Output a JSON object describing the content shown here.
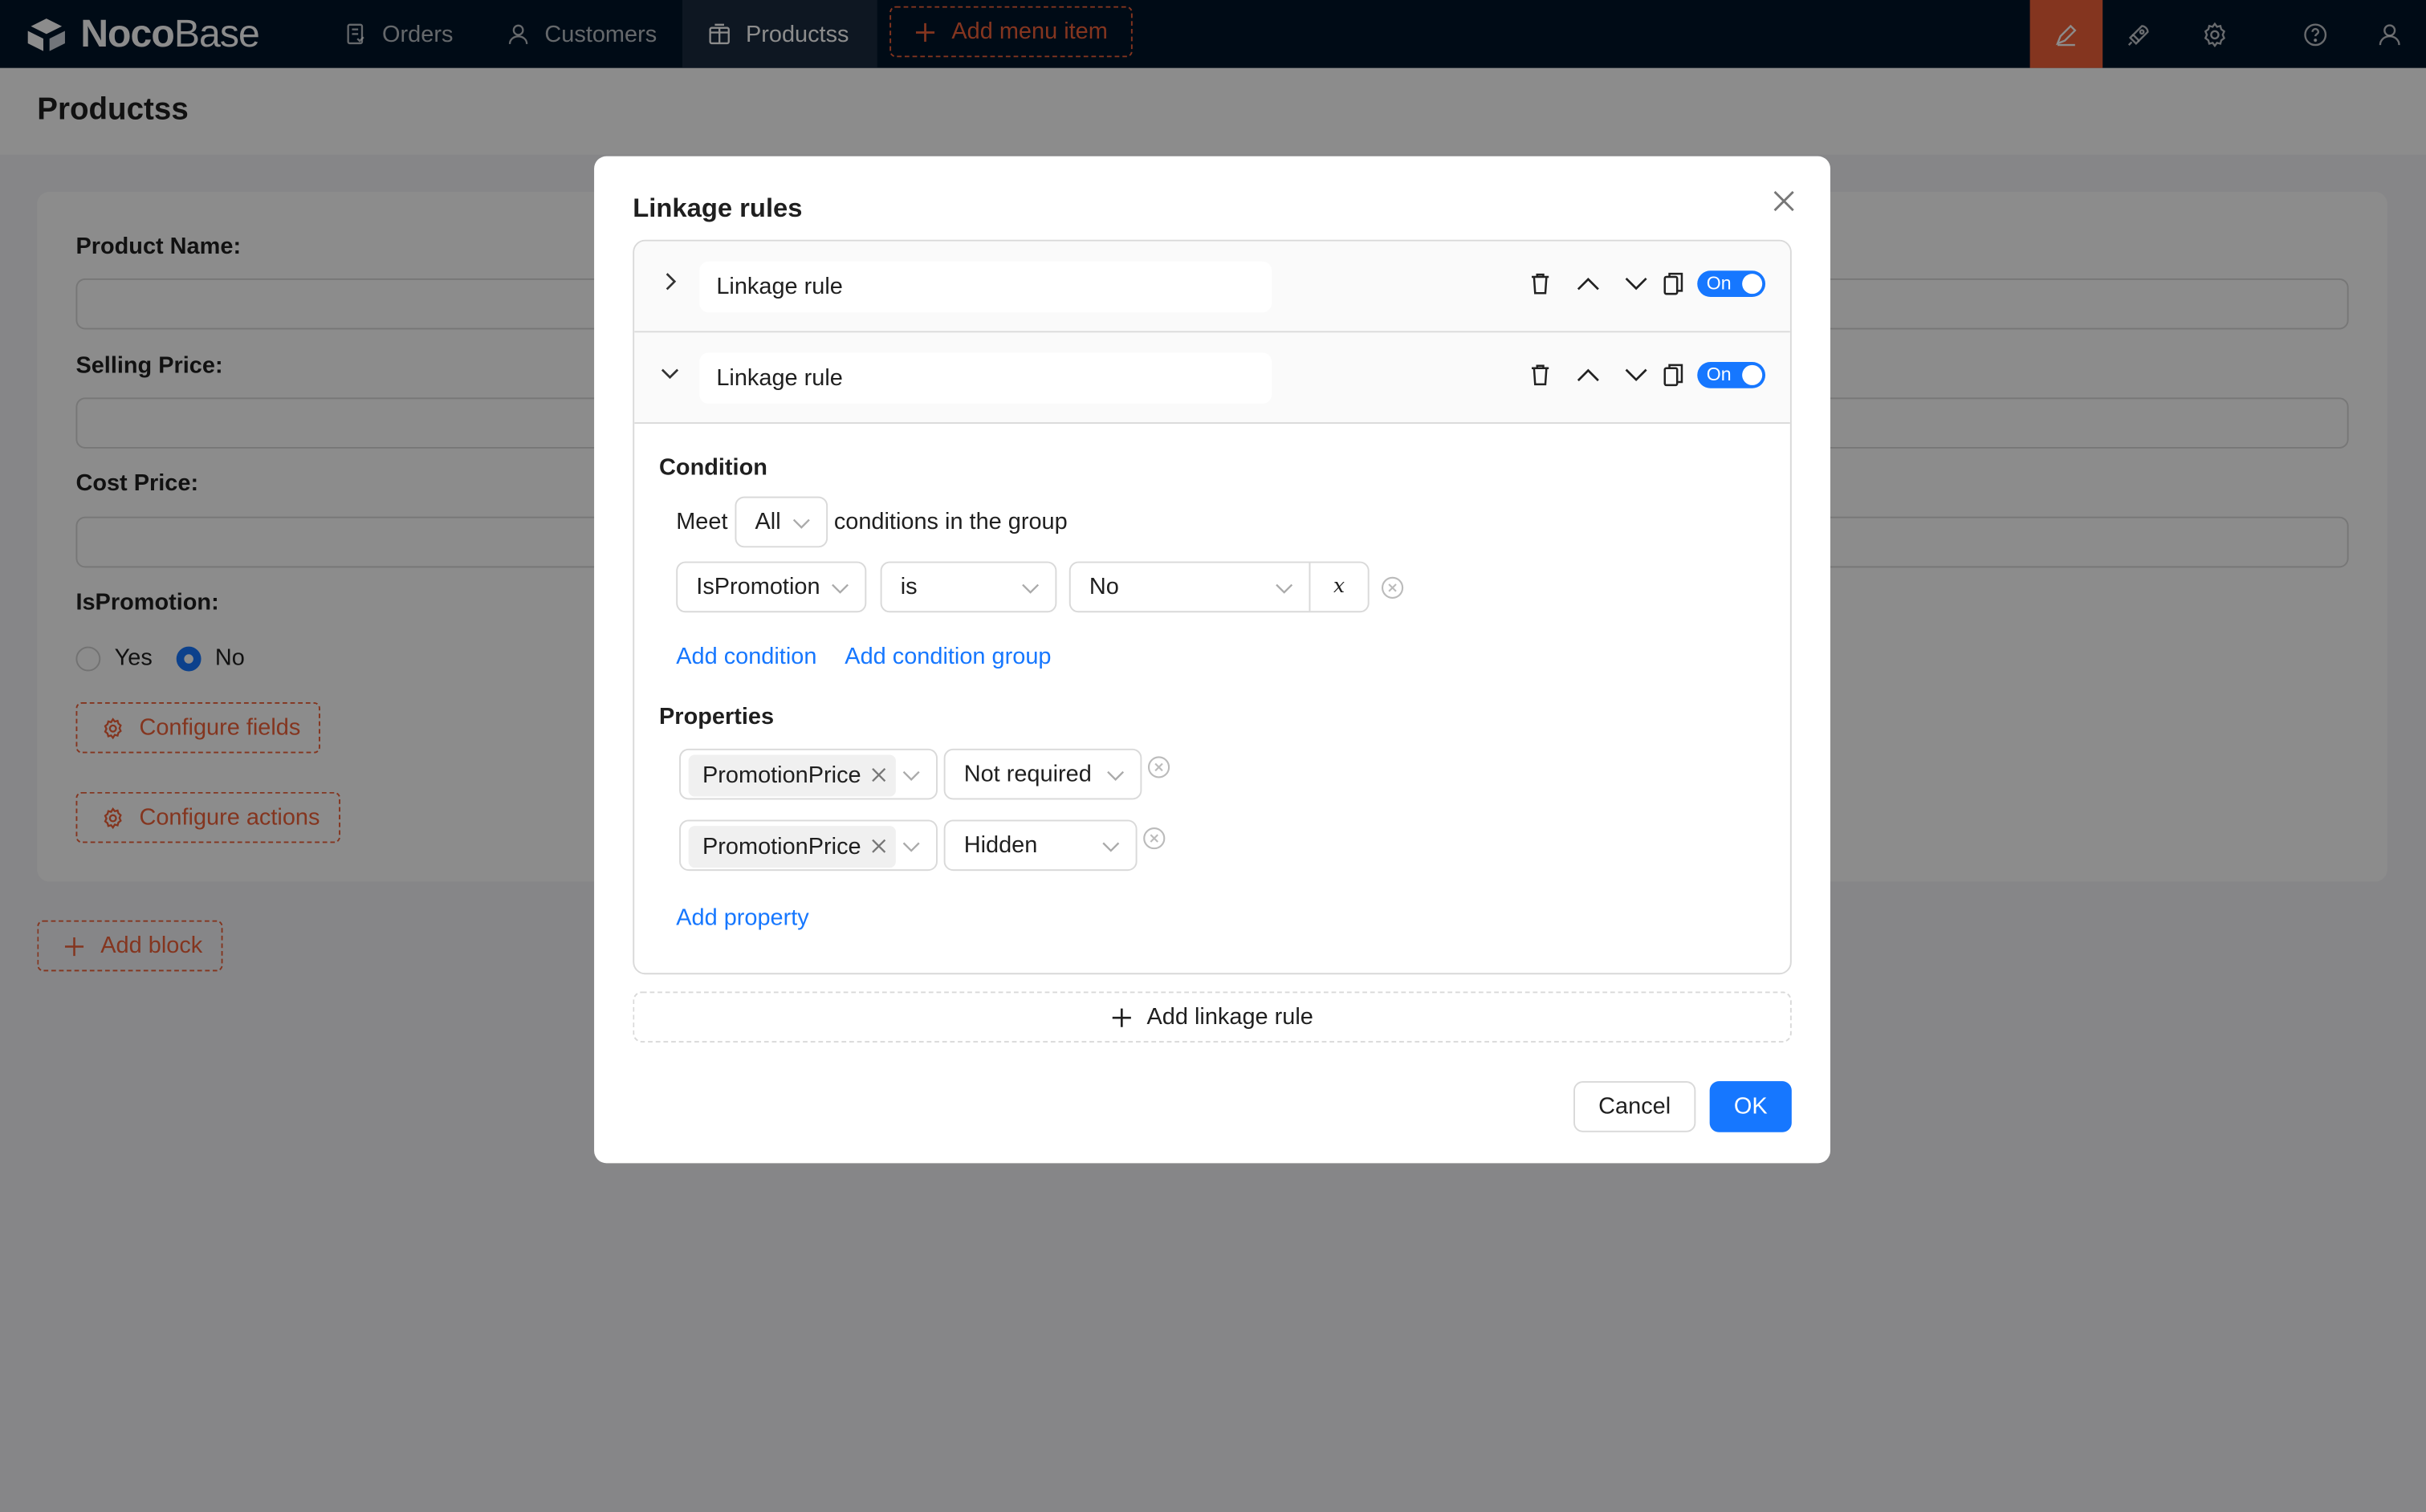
{
  "app": {
    "logo_bold": "Noco",
    "logo_light": "Base"
  },
  "nav": {
    "items": [
      {
        "label": "Orders",
        "icon": "file-icon"
      },
      {
        "label": "Customers",
        "icon": "user-icon"
      },
      {
        "label": "Productss",
        "icon": "table-icon",
        "active": true
      }
    ],
    "add_menu_item": "Add menu item"
  },
  "toolbar_icons": [
    "design-icon",
    "plugin-icon",
    "settings-icon",
    "help-icon",
    "user-icon"
  ],
  "page": {
    "title": "Productss",
    "fields": [
      {
        "label": "Product Name",
        "value": ""
      },
      {
        "label": "Selling Price",
        "value": ""
      },
      {
        "label": "Cost Price",
        "value": ""
      }
    ],
    "is_promotion": {
      "label": "IsPromotion",
      "options": [
        "Yes",
        "No"
      ],
      "selected": "No"
    },
    "colon": ":",
    "configure_fields": "Configure fields",
    "configure_actions": "Configure actions",
    "add_block": "Add block"
  },
  "modal": {
    "title": "Linkage rules",
    "rules": [
      {
        "name": "Linkage rule",
        "expanded": false,
        "switch": "On"
      },
      {
        "name": "Linkage rule",
        "expanded": true,
        "switch": "On"
      }
    ],
    "condition": {
      "title": "Condition",
      "meet_prefix": "Meet",
      "meet_value": "All",
      "meet_suffix": "conditions in the group",
      "row": {
        "field": "IsPromotion",
        "operator": "is",
        "value": "No",
        "variable_symbol": "x"
      },
      "add_condition": "Add condition",
      "add_condition_group": "Add condition group"
    },
    "properties": {
      "title": "Properties",
      "rows": [
        {
          "field_tag": "PromotionPrice",
          "action": "Not required"
        },
        {
          "field_tag": "PromotionPrice",
          "action": "Hidden"
        }
      ],
      "add_property": "Add property"
    },
    "add_linkage_rule": "Add linkage rule",
    "cancel": "Cancel",
    "ok": "OK"
  },
  "colors": {
    "accent": "#f0623a",
    "primary": "#1677ff",
    "header_bg": "#001529"
  }
}
